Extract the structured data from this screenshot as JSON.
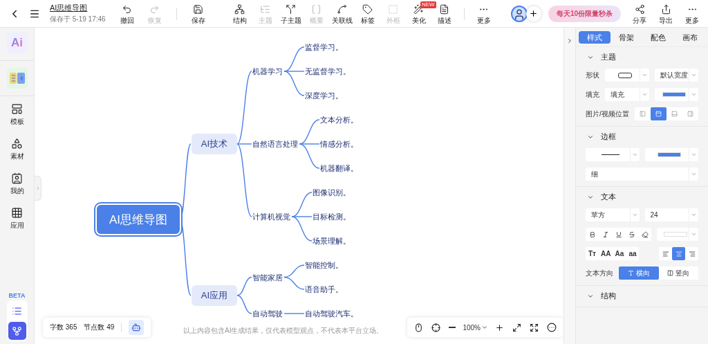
{
  "header": {
    "title": "AI思维导图",
    "saved": "保存于 5-19 17:46"
  },
  "edit_tools": [
    {
      "kind": "undo",
      "label": "撤回",
      "disabled": false
    },
    {
      "kind": "redo",
      "label": "恢复",
      "disabled": true
    },
    {
      "kind": "save",
      "label": "保存",
      "disabled": false
    }
  ],
  "tools": [
    {
      "kind": "structure",
      "label": "结构",
      "disabled": false
    },
    {
      "kind": "topic",
      "label": "主题",
      "disabled": true
    },
    {
      "kind": "subtopic",
      "label": "子主题",
      "disabled": false
    },
    {
      "kind": "summary",
      "label": "概要",
      "disabled": true
    },
    {
      "kind": "relation",
      "label": "关联线",
      "disabled": false
    },
    {
      "kind": "tag",
      "label": "标签",
      "disabled": false
    },
    {
      "kind": "frame",
      "label": "外框",
      "disabled": true
    },
    {
      "kind": "beautify",
      "label": "美化",
      "disabled": false,
      "badge": "NEW"
    },
    {
      "kind": "describe",
      "label": "描述",
      "disabled": false
    },
    {
      "kind": "more",
      "label": "更多",
      "disabled": false
    }
  ],
  "promo": "每天10份限量秒杀",
  "header_actions": [
    {
      "kind": "share",
      "label": "分享"
    },
    {
      "kind": "export",
      "label": "导出"
    },
    {
      "kind": "more",
      "label": "更多"
    }
  ],
  "sidebar": {
    "ai_tile": "Ai",
    "items": [
      {
        "kind": "template",
        "label": "模板"
      },
      {
        "kind": "material",
        "label": "素材"
      },
      {
        "kind": "mine",
        "label": "我的"
      },
      {
        "kind": "apps",
        "label": "应用"
      }
    ],
    "beta": "BETA",
    "views": [
      {
        "kind": "outline",
        "selected": false
      },
      {
        "kind": "mindmap",
        "selected": true
      }
    ]
  },
  "mindmap": {
    "root": {
      "label": "AI思维导图",
      "selected": true,
      "children": [
        {
          "label": "AI技术",
          "children": [
            {
              "label": "机器学习",
              "children": [
                {
                  "label": "监督学习。"
                },
                {
                  "label": "无监督学习。"
                },
                {
                  "label": "深度学习。"
                }
              ]
            },
            {
              "label": "自然语言处理",
              "children": [
                {
                  "label": "文本分析。"
                },
                {
                  "label": "情感分析。"
                },
                {
                  "label": "机器翻译。"
                }
              ]
            },
            {
              "label": "计算机视觉",
              "children": [
                {
                  "label": "图像识别。"
                },
                {
                  "label": "目标检测。"
                },
                {
                  "label": "场景理解。"
                }
              ]
            }
          ]
        },
        {
          "label": "AI应用",
          "children": [
            {
              "label": "智能家居",
              "children": [
                {
                  "label": "智能控制。"
                },
                {
                  "label": "语音助手。"
                }
              ]
            },
            {
              "label": "自动驾驶",
              "children": [
                {
                  "label": "自动驾驶汽车。"
                }
              ]
            }
          ]
        }
      ]
    }
  },
  "status": {
    "word_count": "字数 365",
    "node_count": "节点数 49"
  },
  "disclaimer": "以上内容包含AI生成结果，仅代表模型观点，不代表本平台立场。",
  "zoom_bar": {
    "zoom": "100%"
  },
  "panel": {
    "tabs": [
      {
        "label": "样式",
        "selected": true
      },
      {
        "label": "骨架",
        "selected": false
      },
      {
        "label": "配色",
        "selected": false
      },
      {
        "label": "画布",
        "selected": false
      }
    ],
    "sections": [
      {
        "title": "主题",
        "expanded": true,
        "rows": [
          {
            "kind": "selects",
            "label": "形状",
            "selects": [
              {
                "kind": "shape"
              },
              {
                "kind": "text",
                "value": "默认宽度"
              }
            ]
          },
          {
            "kind": "selects",
            "label": "填充",
            "selects": [
              {
                "kind": "text",
                "value": "填充"
              },
              {
                "kind": "color",
                "color": "#4a80e8"
              }
            ]
          },
          {
            "kind": "segmented",
            "label": "图片/视频位置",
            "options": [
              {
                "kind": "left",
                "selected": false
              },
              {
                "kind": "top",
                "selected": true
              },
              {
                "kind": "bottom",
                "selected": false
              },
              {
                "kind": "right",
                "selected": false
              }
            ]
          }
        ]
      },
      {
        "title": "边框",
        "expanded": true,
        "rows": [
          {
            "kind": "selects",
            "selects": [
              {
                "kind": "line"
              },
              {
                "kind": "color",
                "color": "#4a80e8"
              }
            ]
          },
          {
            "kind": "selects",
            "selects": [
              {
                "kind": "wide",
                "value": "细"
              }
            ]
          }
        ]
      },
      {
        "title": "文本",
        "expanded": true,
        "rows": [
          {
            "kind": "selects",
            "selects": [
              {
                "kind": "text",
                "value": "苹方"
              },
              {
                "kind": "text",
                "value": "24"
              }
            ]
          },
          {
            "kind": "format",
            "buttons": [
              {
                "kind": "bold"
              },
              {
                "kind": "italic"
              },
              {
                "kind": "underline"
              },
              {
                "kind": "strike"
              },
              {
                "kind": "eraser"
              }
            ],
            "selects": [
              {
                "kind": "color",
                "color": "#ffffff"
              }
            ]
          },
          {
            "kind": "case",
            "cases": [
              "Tт",
              "AA",
              "Aa",
              "aa"
            ],
            "aligns": [
              {
                "kind": "left",
                "selected": false
              },
              {
                "kind": "center",
                "selected": true
              },
              {
                "kind": "right",
                "selected": false
              }
            ]
          },
          {
            "kind": "direction",
            "label": "文本方向",
            "options": [
              {
                "kind": "horizontal",
                "label": "横向",
                "selected": true
              },
              {
                "kind": "vertical",
                "label": "竖向",
                "selected": false
              }
            ]
          }
        ]
      },
      {
        "title": "结构",
        "expanded": true
      }
    ]
  }
}
